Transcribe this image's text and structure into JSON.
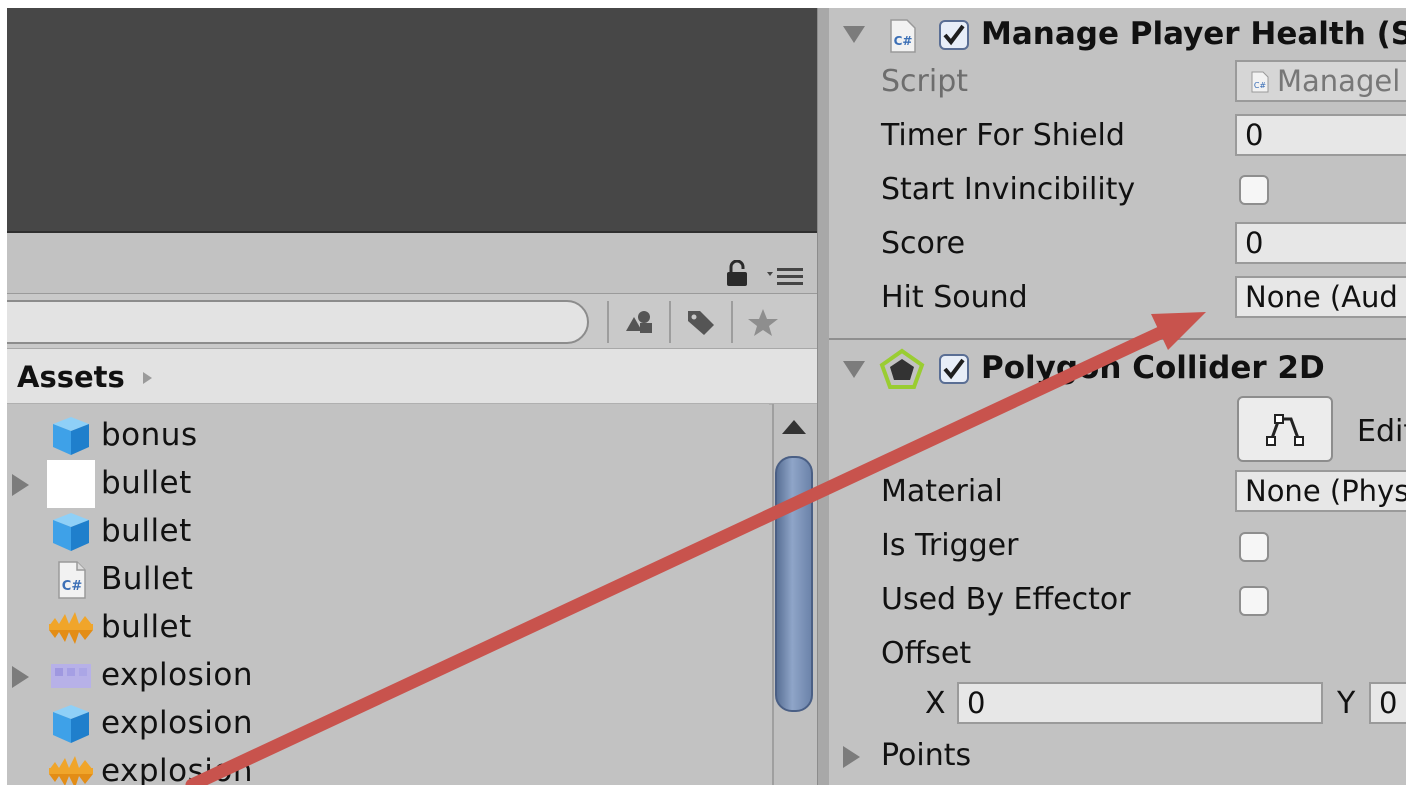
{
  "project": {
    "header": "Assets",
    "items": [
      {
        "label": "bonus",
        "icon": "prefab-cube-icon",
        "expandable": false
      },
      {
        "label": "bullet",
        "icon": "white-texture-icon",
        "expandable": true
      },
      {
        "label": "bullet",
        "icon": "prefab-cube-icon",
        "expandable": false
      },
      {
        "label": "Bullet",
        "icon": "csharp-script-icon",
        "expandable": false
      },
      {
        "label": "bullet",
        "icon": "animation-clip-icon",
        "expandable": false
      },
      {
        "label": "explosion",
        "icon": "sprite-sheet-icon",
        "expandable": true
      },
      {
        "label": "explosion",
        "icon": "prefab-cube-icon",
        "expandable": false
      },
      {
        "label": "explosion",
        "icon": "animation-clip-icon",
        "expandable": false
      }
    ],
    "toolbar_icons": [
      "search-by-type-icon",
      "search-by-label-icon",
      "favorites-star-icon"
    ]
  },
  "inspector": {
    "script_component": {
      "title": "Manage Player Health (Scr",
      "enabled": true,
      "icon_text": "C#",
      "fields": {
        "script_label": "Script",
        "script_value": "Managel",
        "timer_label": "Timer For Shield",
        "timer_value": "0",
        "invincibility_label": "Start Invincibility",
        "invincibility_checked": false,
        "score_label": "Score",
        "score_value": "0",
        "hitsound_label": "Hit Sound",
        "hitsound_value": "None (Aud"
      }
    },
    "collider_component": {
      "title": "Polygon Collider 2D",
      "enabled": true,
      "edit_label": "Edit",
      "fields": {
        "material_label": "Material",
        "material_value": "None (Phys",
        "trigger_label": "Is Trigger",
        "trigger_checked": false,
        "effector_label": "Used By Effector",
        "effector_checked": false,
        "offset_label": "Offset",
        "offset_x_label": "X",
        "offset_x_value": "0",
        "offset_y_label": "Y",
        "offset_y_value": "0",
        "points_label": "Points"
      }
    }
  },
  "annotation": {
    "arrow_color": "#c8534d"
  },
  "colors": {
    "panel_bg": "#c2c2c2",
    "scene_bg": "#474747",
    "checkbox_accent": "#3564a8",
    "scroll_thumb": "#6f86ad"
  }
}
